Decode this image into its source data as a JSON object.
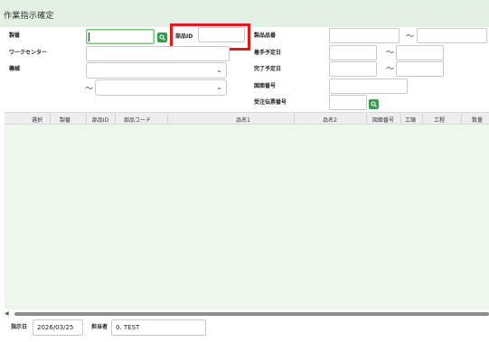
{
  "window": {
    "title": "作業指示確定"
  },
  "form": {
    "seiban_label": "製番",
    "buhin_id_label": "部品ID",
    "seihin_hinban_label": "製品品番",
    "work_center_label": "ワークセンター",
    "chakushu_label": "着手予定日",
    "kikai_label": "機械",
    "kanryo_label": "完了予定日",
    "zumen_label": "図面番号",
    "juchu_label": "受注伝票番号",
    "tilde": "～"
  },
  "grid": {
    "columns": [
      "選択",
      "製番",
      "部品ID",
      "部品コード",
      "品名1",
      "品名2",
      "図面番号",
      "工順",
      "工程",
      "数量"
    ]
  },
  "footer": {
    "shiji_label": "指示日",
    "shiji_value": "2026/03/25",
    "tanto_label": "担当者",
    "tanto_value": "0. TEST"
  },
  "colors": {
    "title_bg": "#e2f1e3",
    "grid_bg": "#eef6ee",
    "search_button": "#3a9a4f",
    "highlight": "#e11b1b"
  }
}
